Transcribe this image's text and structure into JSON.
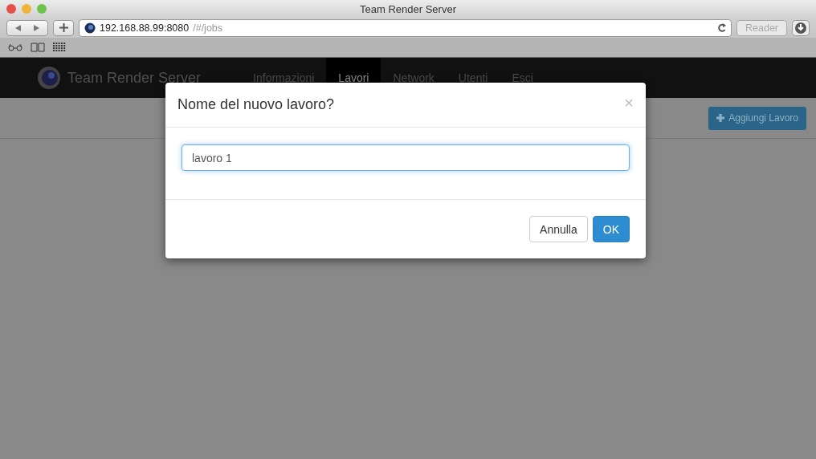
{
  "window": {
    "title": "Team Render Server"
  },
  "toolbar": {
    "url_host": "192.168.88.99:8080",
    "url_path": "/#/jobs",
    "reader_button": "Reader"
  },
  "navbar": {
    "brand": "Team Render Server",
    "items": [
      {
        "label": "Informazioni",
        "selected": false
      },
      {
        "label": "Lavori",
        "selected": true
      },
      {
        "label": "Network",
        "selected": false
      },
      {
        "label": "Utenti",
        "selected": false
      },
      {
        "label": "Esci",
        "selected": false
      }
    ]
  },
  "add_button": {
    "label": "Aggiungi Lavoro"
  },
  "dialog": {
    "title": "Nome del nuovo lavoro?",
    "close": "×",
    "input": {
      "value": "lavoro 1"
    },
    "buttons": [
      {
        "label": "Annulla",
        "kind": "default"
      },
      {
        "label": "OK",
        "kind": "primary"
      }
    ]
  }
}
